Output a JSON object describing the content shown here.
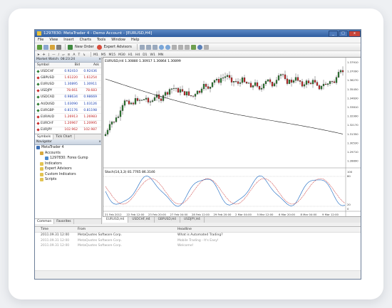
{
  "window": {
    "title": "1297830: MetaTrader 4 - Demo Account - [EURUSD,H4]",
    "controls": [
      "_",
      "□",
      "x"
    ]
  },
  "menu": [
    "File",
    "View",
    "Insert",
    "Charts",
    "Tools",
    "Window",
    "Help"
  ],
  "toolbar": {
    "new_order": "New Order",
    "expert_advisors": "Expert Advisors",
    "timeframes": [
      "M1",
      "M5",
      "M15",
      "M30",
      "H1",
      "H4",
      "D1",
      "W1",
      "MN"
    ]
  },
  "market_watch": {
    "title": "Market Watch: 08:23:24",
    "columns": [
      "Symbol",
      "Bid",
      "Ask"
    ],
    "rows": [
      {
        "symbol": "USDCHF",
        "bid": "0.92410",
        "ask": "0.92436",
        "dir": "up"
      },
      {
        "symbol": "GBPUSD",
        "bid": "1.61220",
        "ask": "1.61254",
        "dir": "dn"
      },
      {
        "symbol": "EURUSD",
        "bid": "1.30895",
        "ask": "1.30911",
        "dir": "up"
      },
      {
        "symbol": "USDJPY",
        "bid": "78.661",
        "ask": "78.683",
        "dir": "dn"
      },
      {
        "symbol": "USDCAD",
        "bid": "0.98634",
        "ask": "0.98669",
        "dir": "up"
      },
      {
        "symbol": "AUDUSD",
        "bid": "1.03090",
        "ask": "1.03126",
        "dir": "up"
      },
      {
        "symbol": "EURGBP",
        "bid": "0.81176",
        "ask": "0.81198",
        "dir": "up"
      },
      {
        "symbol": "EURAUD",
        "bid": "1.26913",
        "ask": "1.26983",
        "dir": "dn"
      },
      {
        "symbol": "EURCHF",
        "bid": "1.20967",
        "ask": "1.20995",
        "dir": "dn"
      },
      {
        "symbol": "EURJPY",
        "bid": "102.962",
        "ask": "102.987",
        "dir": "dn"
      }
    ],
    "tabs": [
      "Symbols",
      "Tick Chart"
    ]
  },
  "navigator": {
    "title": "Navigator",
    "items": [
      "MetaTrader 4",
      "Accounts",
      "1297830: Forex Gump",
      "Indicators",
      "Expert Advisors",
      "Custom Indicators",
      "Scripts"
    ],
    "tabs": [
      "Common",
      "Favorites"
    ]
  },
  "chart": {
    "header": "EURUSD,H4  1.30880 1.30917 1.30864 1.30899",
    "osc_header": "Stoch(14,3,3) 81.7765 86.3146",
    "price_ticks": [
      "1.37910",
      "1.37090",
      "1.36270",
      "1.35450",
      "1.34630",
      "1.33810",
      "1.32990",
      "1.32170",
      "1.31350",
      "1.30530",
      "1.29710",
      "1.28890"
    ],
    "osc_ticks": [
      "100",
      "80",
      "20",
      "0"
    ],
    "time_ticks": [
      "21 Feb 2012",
      "22 Feb 12:00",
      "23 Feb 20:00",
      "27 Feb 04:00",
      "28 Feb 12:00",
      "29 Feb 20:00",
      "2 Mar 04:00",
      "5 Mar 12:00",
      "6 Mar 20:00",
      "8 Mar 04:00",
      "9 Mar 12:00"
    ],
    "colors": {
      "bull": "#2e7d32",
      "bear": "#c62828",
      "ma": "#1b1b1b",
      "osc_main": "#1565c0",
      "osc_signal": "#c62828"
    }
  },
  "chart_tabs": [
    "EURUSD,H4",
    "USDCHF,H4",
    "GBPUSD,H4",
    "USDJPY,H4"
  ],
  "terminal": {
    "columns": [
      "Time",
      "From",
      "Headline"
    ],
    "rows": [
      {
        "time": "2011.09.31 12:00",
        "from": "MetaQuotes Software Corp.",
        "headline": "What is Automated Trading?"
      },
      {
        "time": "2011.09.31 12:00",
        "from": "MetaQuotes Software Corp.",
        "headline": "Mobile Trading - It's Easy!"
      },
      {
        "time": "2011.09.31 12:00",
        "from": "MetaQuotes Software Corp.",
        "headline": "Welcome!"
      }
    ]
  }
}
